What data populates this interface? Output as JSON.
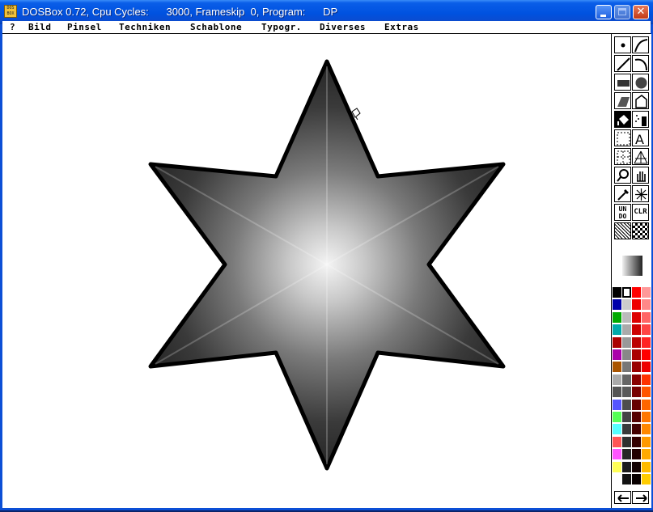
{
  "window": {
    "title": "DOSBox 0.72, Cpu Cycles:      3000, Frameskip  0, Program:      DP",
    "icon_label": "DOS BOX",
    "buttons": [
      "minimize-icon",
      "maximize-icon",
      "close-icon"
    ]
  },
  "menu": [
    "?",
    "Bild",
    "Pinsel",
    "Techniken",
    "Schablone",
    "Typogr.",
    "Diverses",
    "Extras"
  ],
  "tools": {
    "undo_label": "UNDO",
    "clr_label": "CLR",
    "text_label": "A",
    "icons": [
      "dot-brush-icon",
      "freehand-curve-icon",
      "line-icon",
      "curve-icon",
      "rectangle-icon",
      "circle-icon",
      "ellipse-icon",
      "polygon-icon",
      "fill-bucket-icon",
      "airbrush-icon",
      "brush-select-icon",
      "text-icon",
      "grid-icon",
      "perspective-icon",
      "magnify-icon",
      "hand-icon",
      "eyedropper-icon",
      "symmetry-icon",
      "undo-icon",
      "clear-icon",
      "pattern-icon",
      "checker-icon",
      "gradient-swatch-icon",
      "arrow-left-icon",
      "arrow-right-icon"
    ]
  },
  "colors": {
    "foreground": "#000000",
    "background": "#ffffff",
    "palette_col1": [
      "#000000",
      "#0000aa",
      "#00aa00",
      "#00aaaa",
      "#aa0000",
      "#aa00aa",
      "#aa5500",
      "#aaaaaa",
      "#555555",
      "#5555ff",
      "#55ff55",
      "#55ffff",
      "#ff5555",
      "#ff55ff",
      "#ffff55",
      "#ffffff"
    ],
    "palette_col2": [
      "#ffffff",
      "#cccccc",
      "#bbbbbb",
      "#aaaaaa",
      "#999999",
      "#888888",
      "#777777",
      "#666666",
      "#5a5a5a",
      "#4e4e4e",
      "#444444",
      "#3a3a3a",
      "#303030",
      "#262626",
      "#1c1c1c",
      "#121212"
    ],
    "palette_col3": [
      "#ff0000",
      "#ee0000",
      "#dd0000",
      "#cc0000",
      "#bb0000",
      "#aa0000",
      "#990000",
      "#880000",
      "#770000",
      "#660000",
      "#550000",
      "#440000",
      "#330000",
      "#220000",
      "#110000",
      "#080000"
    ],
    "palette_col4": [
      "#ff9999",
      "#ff8888",
      "#ff6666",
      "#ff4444",
      "#ff2222",
      "#ff0000",
      "#ee0000",
      "#ff3300",
      "#ff5500",
      "#ff6600",
      "#ff7700",
      "#ff8800",
      "#ff9900",
      "#ffaa00",
      "#ffbb00",
      "#ffcc00"
    ]
  }
}
